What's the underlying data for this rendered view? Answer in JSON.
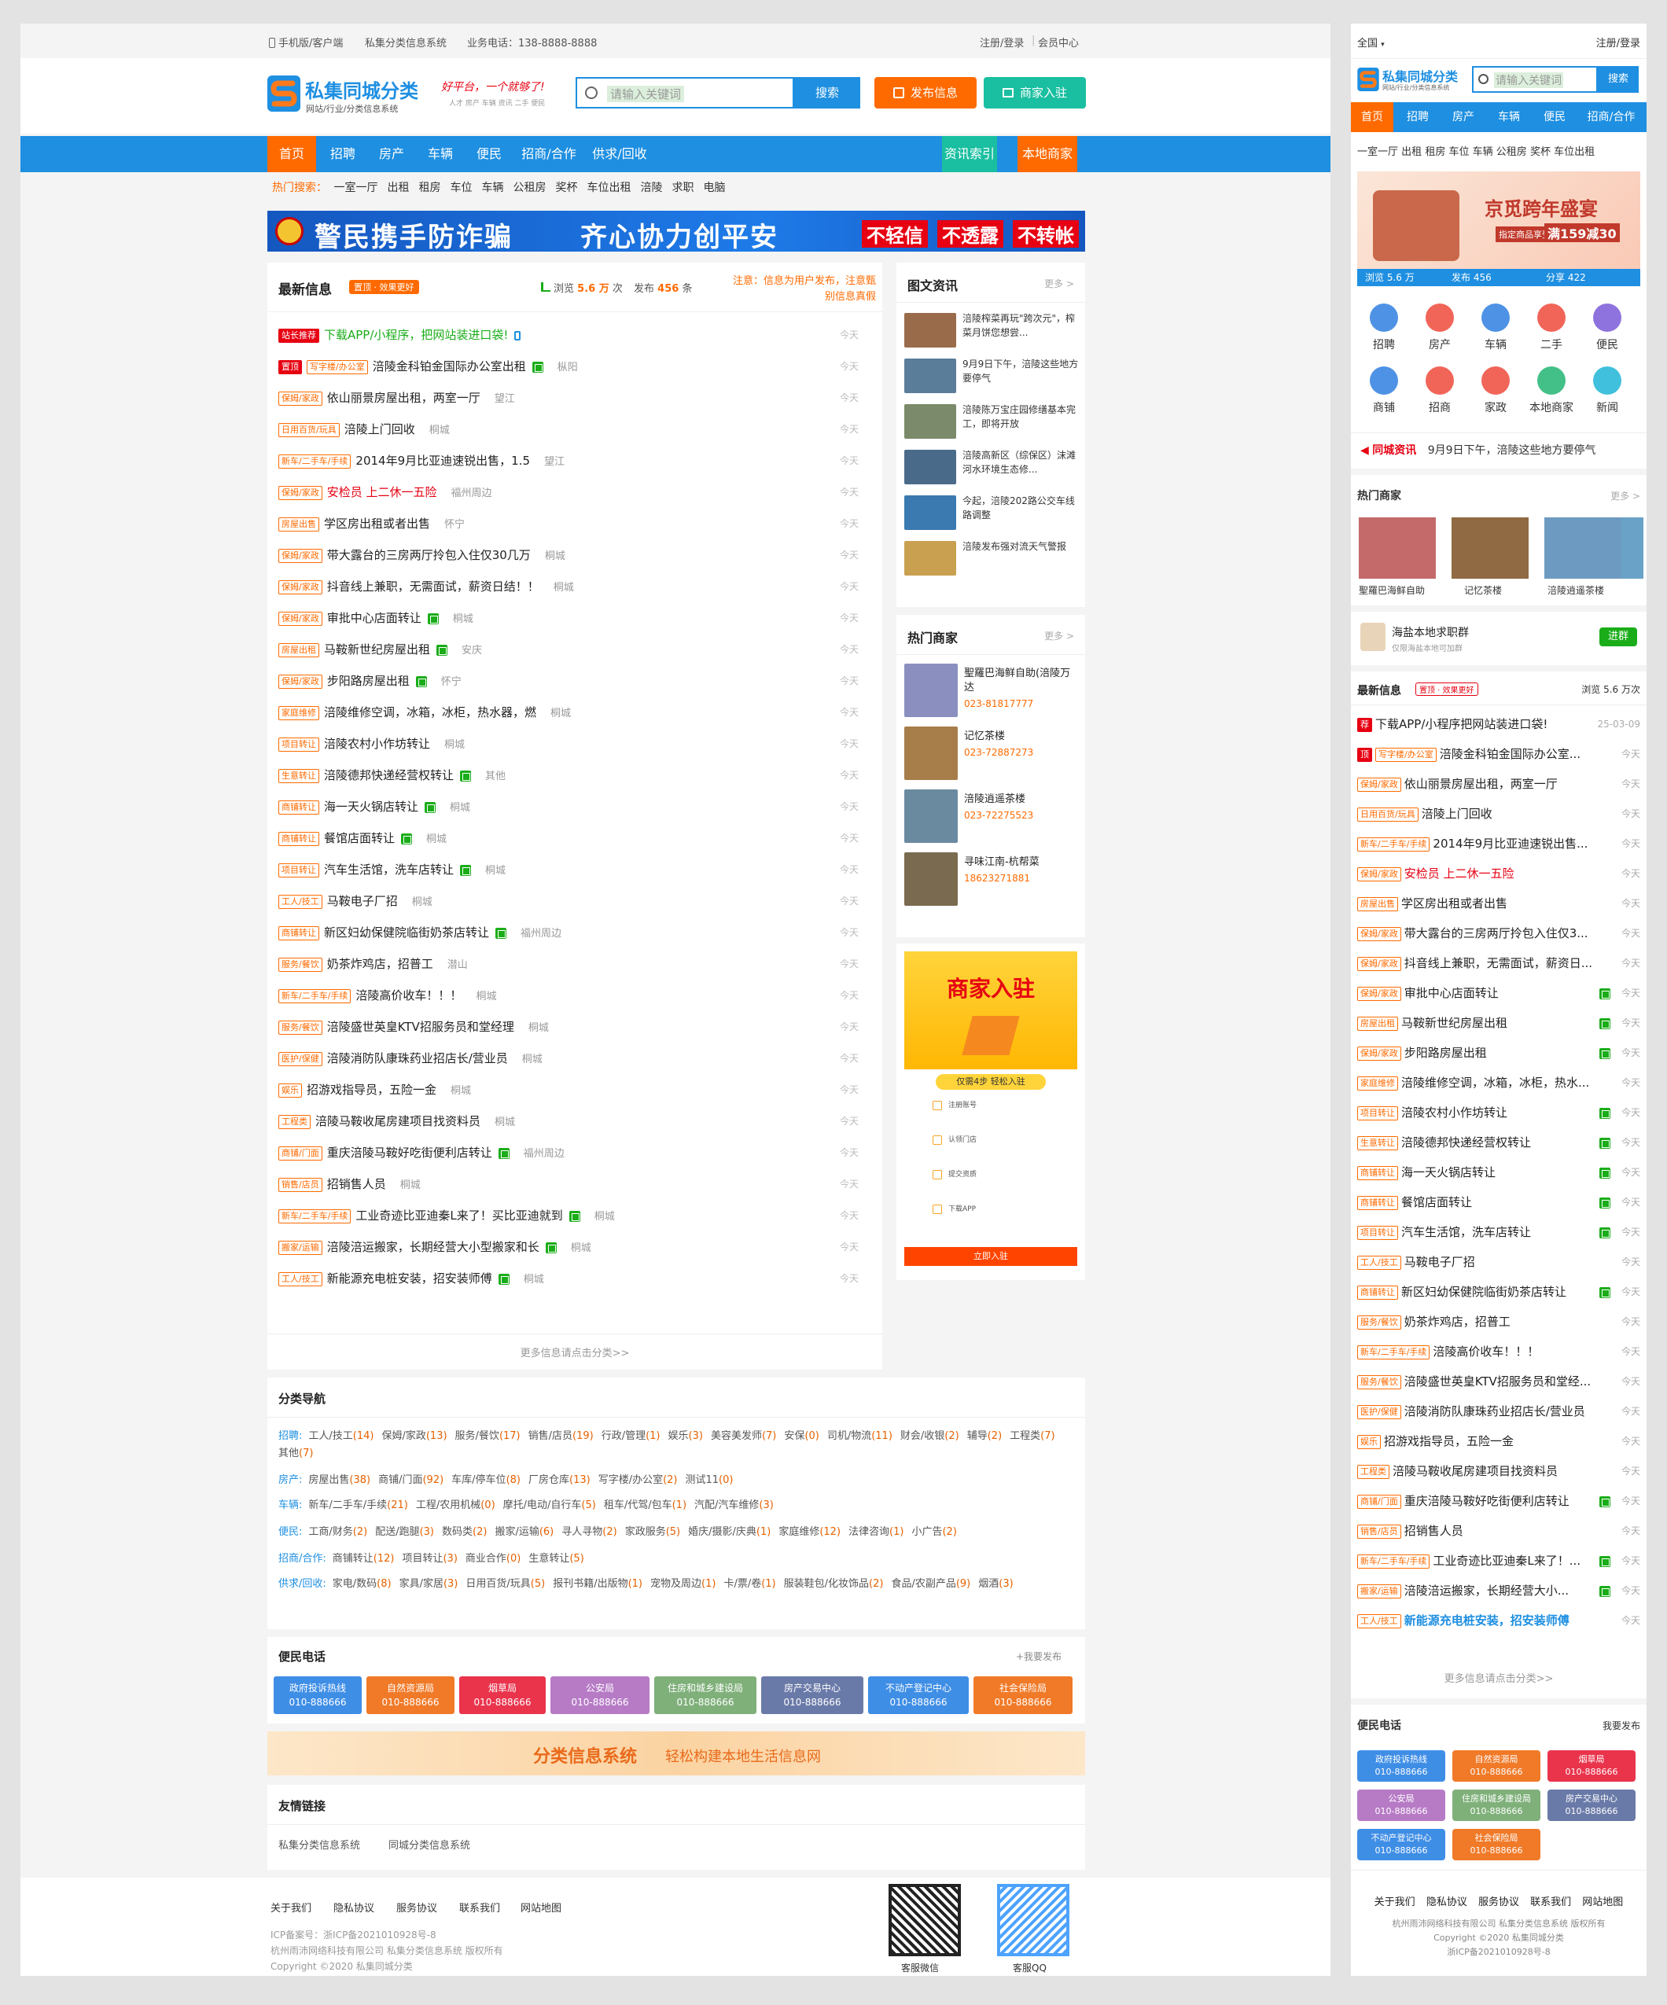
{
  "top": {
    "mobile": "手机版/客户端",
    "site": "私集分类信息系统",
    "phone": "业务电话：138-8888-8888",
    "login": "注册/登录",
    "sep": "|",
    "member": "会员中心"
  },
  "logo": {
    "brand": "私集同城分类",
    "sub": "网站/行业/分类信息系统",
    "slogan": "好平台，一个就够了!",
    "slogan_tags": "人才 房产 车辆 资讯 二手 便民"
  },
  "search": {
    "placeholder": "请输入关键词",
    "button": "搜索"
  },
  "buttons": {
    "post": "发布信息",
    "join": "商家入驻"
  },
  "nav": {
    "items": [
      "首页",
      "招聘",
      "房产",
      "车辆",
      "便民",
      "招商/合作",
      "供求/回收"
    ],
    "news_index": "资讯索引",
    "local_biz": "本地商家"
  },
  "hot": {
    "label": "热门搜索：",
    "words": [
      "一室一厅",
      "出租",
      "租房",
      "车位",
      "车辆",
      "公租房",
      "奖杯",
      "车位出租",
      "涪陵",
      "求职",
      "电脑"
    ]
  },
  "banner": {
    "left": "警民携手防诈骗",
    "mid": "齐心协力创平安",
    "r1": "不轻信",
    "r2": "不透露",
    "r3": "不转帐"
  },
  "latest": {
    "title": "最新信息",
    "badge": "置顶 · 效果更好",
    "views_label": "浏览",
    "views": "5.6 万",
    "views_unit": "次",
    "posts_label": "发布",
    "posts": "456",
    "posts_unit": "条",
    "notice": "注意：信息为用户发布，注意甄别信息真假",
    "items": [
      {
        "tag": "站长推荐",
        "red": true,
        "text": "下载APP/小程序，把网站装进口袋!",
        "loc": "",
        "date": "今天",
        "green": true
      },
      {
        "tag": "置顶",
        "red": true,
        "tag2": "写字楼/办公室",
        "text": "涪陵金科铂金国际办公室出租",
        "loc": "枞阳",
        "date": "今天",
        "pic": true
      },
      {
        "tag": "保姆/家政",
        "text": "依山丽景房屋出租，两室一厅",
        "loc": "望江",
        "date": "今天"
      },
      {
        "tag": "日用百货/玩具",
        "text": "涪陵上门回收",
        "loc": "桐城",
        "date": "今天"
      },
      {
        "tag": "新车/二手车/手续",
        "text": "2014年9月比亚迪速锐出售，1.5",
        "loc": "望江",
        "date": "今天"
      },
      {
        "tag": "保姆/家政",
        "text": "安检员 上二休一五险",
        "loc": "福州周边",
        "date": "今天",
        "orange": true
      },
      {
        "tag": "房屋出售",
        "text": "学区房出租或者出售",
        "loc": "怀宁",
        "date": "今天"
      },
      {
        "tag": "保姆/家政",
        "text": "带大露台的三房两厅拎包入住仅30几万",
        "loc": "桐城",
        "date": "今天"
      },
      {
        "tag": "保姆/家政",
        "text": "抖音线上兼职，无需面试，薪资日结！！",
        "loc": "桐城",
        "date": "今天"
      },
      {
        "tag": "保姆/家政",
        "text": "审批中心店面转让",
        "loc": "桐城",
        "date": "今天",
        "pic": true
      },
      {
        "tag": "房屋出租",
        "text": "马鞍新世纪房屋出租",
        "loc": "安庆",
        "date": "今天",
        "pic": true
      },
      {
        "tag": "保姆/家政",
        "text": "步阳路房屋出租",
        "loc": "怀宁",
        "date": "今天",
        "pic": true
      },
      {
        "tag": "家庭维修",
        "text": "涪陵维修空调，冰箱，冰柜，热水器，燃",
        "loc": "桐城",
        "date": "今天"
      },
      {
        "tag": "项目转让",
        "text": "涪陵农村小作坊转让",
        "loc": "桐城",
        "date": "今天"
      },
      {
        "tag": "生意转让",
        "text": "涪陵德邦快递经营权转让",
        "loc": "其他",
        "date": "今天",
        "pic": true
      },
      {
        "tag": "商铺转让",
        "text": "海一天火锅店转让",
        "loc": "桐城",
        "date": "今天",
        "pic": true
      },
      {
        "tag": "商铺转让",
        "text": "餐馆店面转让",
        "loc": "桐城",
        "date": "今天",
        "pic": true
      },
      {
        "tag": "项目转让",
        "text": "汽车生活馆，洗车店转让",
        "loc": "桐城",
        "date": "今天",
        "pic": true
      },
      {
        "tag": "工人/技工",
        "text": "马鞍电子厂招",
        "loc": "桐城",
        "date": "今天"
      },
      {
        "tag": "商铺转让",
        "text": "新区妇幼保健院临街奶茶店转让",
        "loc": "福州周边",
        "date": "今天",
        "pic": true
      },
      {
        "tag": "服务/餐饮",
        "text": "奶茶炸鸡店，招普工",
        "loc": "潜山",
        "date": "今天"
      },
      {
        "tag": "新车/二手车/手续",
        "text": "涪陵高价收车！！！",
        "loc": "桐城",
        "date": "今天"
      },
      {
        "tag": "服务/餐饮",
        "text": "涪陵盛世英皇KTV招服务员和堂经理",
        "loc": "桐城",
        "date": "今天"
      },
      {
        "tag": "医护/保健",
        "text": "涪陵消防队康珠药业招店长/营业员",
        "loc": "桐城",
        "date": "今天"
      },
      {
        "tag": "娱乐",
        "text": "招游戏指导员，五险一金",
        "loc": "桐城",
        "date": "今天"
      },
      {
        "tag": "工程类",
        "text": "涪陵马鞍收尾房建项目找资料员",
        "loc": "桐城",
        "date": "今天"
      },
      {
        "tag": "商铺/门面",
        "text": "重庆涪陵马鞍好吃街便利店转让",
        "loc": "福州周边",
        "date": "今天",
        "pic": true
      },
      {
        "tag": "销售/店员",
        "text": "招销售人员",
        "loc": "桐城",
        "date": "今天"
      },
      {
        "tag": "新车/二手车/手续",
        "text": "工业奇迹比亚迪秦L来了！买比亚迪就到",
        "loc": "桐城",
        "date": "今天",
        "pic": true
      },
      {
        "tag": "搬家/运输",
        "text": "涪陵涪运搬家，长期经营大小型搬家和长",
        "loc": "桐城",
        "date": "今天",
        "pic": true
      },
      {
        "tag": "工人/技工",
        "text": "新能源充电桩安装，招安装师傅",
        "loc": "桐城",
        "date": "今天",
        "pic": true
      }
    ],
    "more": "更多信息请点击分类>>"
  },
  "news": {
    "title": "图文资讯",
    "more": "更多 >",
    "items": [
      "涪陵榨菜再玩\"跨次元\"，榨菜月饼您想尝...",
      "9月9日下午，涪陵这些地方要停气",
      "涪陵陈万宝庄园修缮基本完工，即将开放",
      "涪陵高新区（综保区）沫滩河水环境生态修...",
      "今起，涪陵202路公交车线路调整",
      "涪陵发布强对流天气警报"
    ]
  },
  "biz": {
    "title": "热门商家",
    "more": "更多 >",
    "items": [
      {
        "name": "聖羅巴海鲜自助(涪陵万达",
        "tel": "023-81817777"
      },
      {
        "name": "记忆茶楼",
        "tel": "023-72887273"
      },
      {
        "name": "涪陵逍遥茶楼",
        "tel": "023-72275523"
      },
      {
        "name": "寻味江南-杭帮菜",
        "tel": "18623271881"
      }
    ]
  },
  "ad": {
    "title": "商家入驻",
    "sub": "仅需4步 轻松入驻",
    "steps": [
      "注册账号",
      "认领门店",
      "提交资质",
      "下载APP"
    ],
    "btn": "立即入驻"
  },
  "categories": {
    "title": "分类导航",
    "rows": [
      {
        "label": "招聘:",
        "items": [
          [
            "工人/技工",
            "(14)"
          ],
          [
            "保姆/家政",
            "(13)"
          ],
          [
            "服务/餐饮",
            "(17)"
          ],
          [
            "销售/店员",
            "(19)"
          ],
          [
            "行政/管理",
            "(1)"
          ],
          [
            "娱乐",
            "(3)"
          ],
          [
            "美容美发师",
            "(7)"
          ],
          [
            "安保",
            "(0)"
          ],
          [
            "司机/物流",
            "(11)"
          ],
          [
            "财会/收银",
            "(2)"
          ],
          [
            "辅导",
            "(2)"
          ],
          [
            "工程类",
            "(7)"
          ],
          [
            "其他",
            "(7)"
          ]
        ]
      },
      {
        "label": "房产:",
        "items": [
          [
            "房屋出售",
            "(38)"
          ],
          [
            "商铺/门面",
            "(92)"
          ],
          [
            "车库/停车位",
            "(8)"
          ],
          [
            "厂房仓库",
            "(13)"
          ],
          [
            "写字楼/办公室",
            "(2)"
          ],
          [
            "测试11",
            "(0)"
          ]
        ]
      },
      {
        "label": "车辆:",
        "items": [
          [
            "新车/二手车/手续",
            "(21)"
          ],
          [
            "工程/农用机械",
            "(0)"
          ],
          [
            "摩托/电动/自行车",
            "(5)"
          ],
          [
            "租车/代驾/包车",
            "(1)"
          ],
          [
            "汽配/汽车维修",
            "(3)"
          ]
        ]
      },
      {
        "label": "便民:",
        "items": [
          [
            "工商/财务",
            "(2)"
          ],
          [
            "配送/跑腿",
            "(3)"
          ],
          [
            "数码类",
            "(2)"
          ],
          [
            "搬家/运输",
            "(6)"
          ],
          [
            "寻人寻物",
            "(2)"
          ],
          [
            "家政服务",
            "(5)"
          ],
          [
            "婚庆/摄影/庆典",
            "(1)"
          ],
          [
            "家庭维修",
            "(12)"
          ],
          [
            "法律咨询",
            "(1)"
          ],
          [
            "小广告",
            "(2)"
          ]
        ]
      },
      {
        "label": "招商/合作:",
        "items": [
          [
            "商铺转让",
            "(12)"
          ],
          [
            "项目转让",
            "(3)"
          ],
          [
            "商业合作",
            "(0)"
          ],
          [
            "生意转让",
            "(5)"
          ]
        ]
      },
      {
        "label": "供求/回收:",
        "items": [
          [
            "家电/数码",
            "(8)"
          ],
          [
            "家具/家居",
            "(3)"
          ],
          [
            "日用百货/玩具",
            "(5)"
          ],
          [
            "报刊书籍/出版物",
            "(1)"
          ],
          [
            "宠物及周边",
            "(1)"
          ],
          [
            "卡/票/卷",
            "(1)"
          ],
          [
            "服装鞋包/化妆饰品",
            "(2)"
          ],
          [
            "食品/农副产品",
            "(9)"
          ],
          [
            "烟酒",
            "(3)"
          ]
        ]
      }
    ]
  },
  "phones": {
    "title": "便民电话",
    "post": "+我要发布",
    "items": [
      {
        "name": "政府投诉热线",
        "tel": "010-888666",
        "color": "#3f8ee6"
      },
      {
        "name": "自然资源局",
        "tel": "010-888666",
        "color": "#f07a28"
      },
      {
        "name": "烟草局",
        "tel": "010-888666",
        "color": "#e9344c"
      },
      {
        "name": "公安局",
        "tel": "010-888666",
        "color": "#b77bc6"
      },
      {
        "name": "住房和城乡建设局",
        "tel": "010-888666",
        "color": "#7fb07a"
      },
      {
        "name": "房产交易中心",
        "tel": "010-888666",
        "color": "#6a7aa8"
      },
      {
        "name": "不动产登记中心",
        "tel": "010-888666",
        "color": "#3f8ee6"
      },
      {
        "name": "社会保险局",
        "tel": "010-888666",
        "color": "#f07a28"
      }
    ]
  },
  "banner2": {
    "main": "分类信息系统",
    "sub": "轻松构建本地生活信息网"
  },
  "links": {
    "title": "友情链接",
    "items": [
      "私集分类信息系统",
      "同城分类信息系统"
    ]
  },
  "footer": {
    "links": [
      "关于我们",
      "隐私协议",
      "服务协议",
      "联系我们",
      "网站地图"
    ],
    "icp": "ICP备案号：浙ICP备2021010928号-8",
    "company": "杭州雨沛网络科技有限公司 私集分类信息系统 版权所有",
    "copy": "Copyright ©2020 私集同城分类",
    "qr1": "客服微信",
    "qr2": "客服QQ"
  },
  "mobile": {
    "city": "全国",
    "login": "注册/登录",
    "search_placeholder": "请输入关键词",
    "search_btn": "搜索",
    "nav": [
      "首页",
      "招聘",
      "房产",
      "车辆",
      "便民",
      "招商/合作"
    ],
    "hot": [
      "一室一厅",
      "出租",
      "租房",
      "车位",
      "车辆",
      "公租房",
      "奖杯",
      "车位出租"
    ],
    "banner_title": "京觅跨年盛宴",
    "banner_sub": "指定商品享受",
    "banner_price": "满159减30",
    "stats": {
      "views": "浏览 5.6 万",
      "posts": "发布 456",
      "share": "分享 422"
    },
    "icons": [
      {
        "name": "招聘",
        "color": "#2f7fe0"
      },
      {
        "name": "房产",
        "color": "#ef4a3c"
      },
      {
        "name": "车辆",
        "color": "#2f7fe0"
      },
      {
        "name": "二手",
        "color": "#ef4a3c"
      },
      {
        "name": "便民",
        "color": "#7a5bd8"
      },
      {
        "name": "商铺",
        "color": "#2f7fe0"
      },
      {
        "name": "招商",
        "color": "#ef4a3c"
      },
      {
        "name": "家政",
        "color": "#ef4a3c"
      },
      {
        "name": "本地商家",
        "color": "#22b573"
      },
      {
        "name": "新闻",
        "color": "#1fb5d6"
      }
    ],
    "news_label": "同城资讯",
    "news_text": "9月9日下午，涪陵这些地方要停气",
    "biz_title": "热门商家",
    "biz_more": "更多 >",
    "biz": [
      "聖羅巴海鲜自助",
      "记忆茶楼",
      "涪陵逍遥茶楼"
    ],
    "group_title": "海盐本地求职群",
    "group_sub": "仅限海盐本地可加群",
    "group_btn": "进群",
    "latest_title": "最新信息",
    "latest_badge": "置顶 · 效果更好",
    "latest_views": "浏览 5.6 万次",
    "rows": [
      {
        "tag": "荐",
        "red": true,
        "text": "下载APP/小程序把网站装进口袋!",
        "date": "25-03-09"
      },
      {
        "tag": "顶",
        "red": true,
        "tag2": "写字楼/办公室",
        "text": "涪陵金科铂金国际办公室...",
        "date": "今天"
      },
      {
        "tag": "保姆/家政",
        "text": "依山丽景房屋出租，两室一厅",
        "date": "今天"
      },
      {
        "tag": "日用百货/玩具",
        "text": "涪陵上门回收",
        "date": "今天"
      },
      {
        "tag": "新车/二手车/手续",
        "text": "2014年9月比亚迪速锐出售...",
        "date": "今天"
      },
      {
        "tag": "保姆/家政",
        "text": "安检员 上二休一五险",
        "date": "今天",
        "orange": true
      },
      {
        "tag": "房屋出售",
        "text": "学区房出租或者出售",
        "date": "今天"
      },
      {
        "tag": "保姆/家政",
        "text": "带大露台的三房两厅拎包入住仅3...",
        "date": "今天"
      },
      {
        "tag": "保姆/家政",
        "text": "抖音线上兼职，无需面试，薪资日...",
        "date": "今天"
      },
      {
        "tag": "保姆/家政",
        "text": "审批中心店面转让",
        "date": "今天",
        "pic": true
      },
      {
        "tag": "房屋出租",
        "text": "马鞍新世纪房屋出租",
        "date": "今天",
        "pic": true
      },
      {
        "tag": "保姆/家政",
        "text": "步阳路房屋出租",
        "date": "今天",
        "pic": true
      },
      {
        "tag": "家庭维修",
        "text": "涪陵维修空调，冰箱，冰柜，热水...",
        "date": "今天"
      },
      {
        "tag": "项目转让",
        "text": "涪陵农村小作坊转让",
        "date": "今天",
        "pic": true
      },
      {
        "tag": "生意转让",
        "text": "涪陵德邦快递经营权转让",
        "date": "今天",
        "pic": true
      },
      {
        "tag": "商铺转让",
        "text": "海一天火锅店转让",
        "date": "今天",
        "pic": true
      },
      {
        "tag": "商铺转让",
        "text": "餐馆店面转让",
        "date": "今天",
        "pic": true
      },
      {
        "tag": "项目转让",
        "text": "汽车生活馆，洗车店转让",
        "date": "今天",
        "pic": true
      },
      {
        "tag": "工人/技工",
        "text": "马鞍电子厂招",
        "date": "今天"
      },
      {
        "tag": "商铺转让",
        "text": "新区妇幼保健院临街奶茶店转让",
        "date": "今天",
        "pic": true
      },
      {
        "tag": "服务/餐饮",
        "text": "奶茶炸鸡店，招普工",
        "date": "今天"
      },
      {
        "tag": "新车/二手车/手续",
        "text": "涪陵高价收车！！！",
        "date": "今天"
      },
      {
        "tag": "服务/餐饮",
        "text": "涪陵盛世英皇KTV招服务员和堂经...",
        "date": "今天"
      },
      {
        "tag": "医护/保健",
        "text": "涪陵消防队康珠药业招店长/营业员",
        "date": "今天"
      },
      {
        "tag": "娱乐",
        "text": "招游戏指导员，五险一金",
        "date": "今天"
      },
      {
        "tag": "工程类",
        "text": "涪陵马鞍收尾房建项目找资料员",
        "date": "今天"
      },
      {
        "tag": "商铺/门面",
        "text": "重庆涪陵马鞍好吃街便利店转让",
        "date": "今天",
        "pic": true
      },
      {
        "tag": "销售/店员",
        "text": "招销售人员",
        "date": "今天"
      },
      {
        "tag": "新车/二手车/手续",
        "text": "工业奇迹比亚迪秦L来了！...",
        "date": "今天",
        "pic": true
      },
      {
        "tag": "搬家/运输",
        "text": "涪陵涪运搬家，长期经营大小...",
        "date": "今天",
        "pic": true
      },
      {
        "tag": "工人/技工",
        "text": "新能源充电桩安装，招安装师傅",
        "date": "今天",
        "blue": true
      }
    ],
    "more": "更多信息请点击分类>>",
    "phone_title": "便民电话",
    "phone_post": "我要发布",
    "phones": [
      {
        "name": "政府投诉热线",
        "tel": "010-888666",
        "color": "#3f8ee6"
      },
      {
        "name": "自然资源局",
        "tel": "010-888666",
        "color": "#f07a28"
      },
      {
        "name": "烟草局",
        "tel": "010-888666",
        "color": "#e9344c"
      },
      {
        "name": "公安局",
        "tel": "010-888666",
        "color": "#b77bc6"
      },
      {
        "name": "住房和城乡建设局",
        "tel": "010-888666",
        "color": "#7fb07a"
      },
      {
        "name": "房产交易中心",
        "tel": "010-888666",
        "color": "#6a7aa8"
      },
      {
        "name": "不动产登记中心",
        "tel": "010-888666",
        "color": "#3f8ee6"
      },
      {
        "name": "社会保险局",
        "tel": "010-888666",
        "color": "#f07a28"
      }
    ],
    "footer_links": [
      "关于我们",
      "隐私协议",
      "服务协议",
      "联系我们",
      "网站地图"
    ],
    "footer_company": "杭州雨沛网络科技有限公司 私集分类信息系统 版权所有",
    "footer_copy": "Copyright ©2020 私集同城分类",
    "footer_icp": "浙ICP备2021010928号-8"
  }
}
